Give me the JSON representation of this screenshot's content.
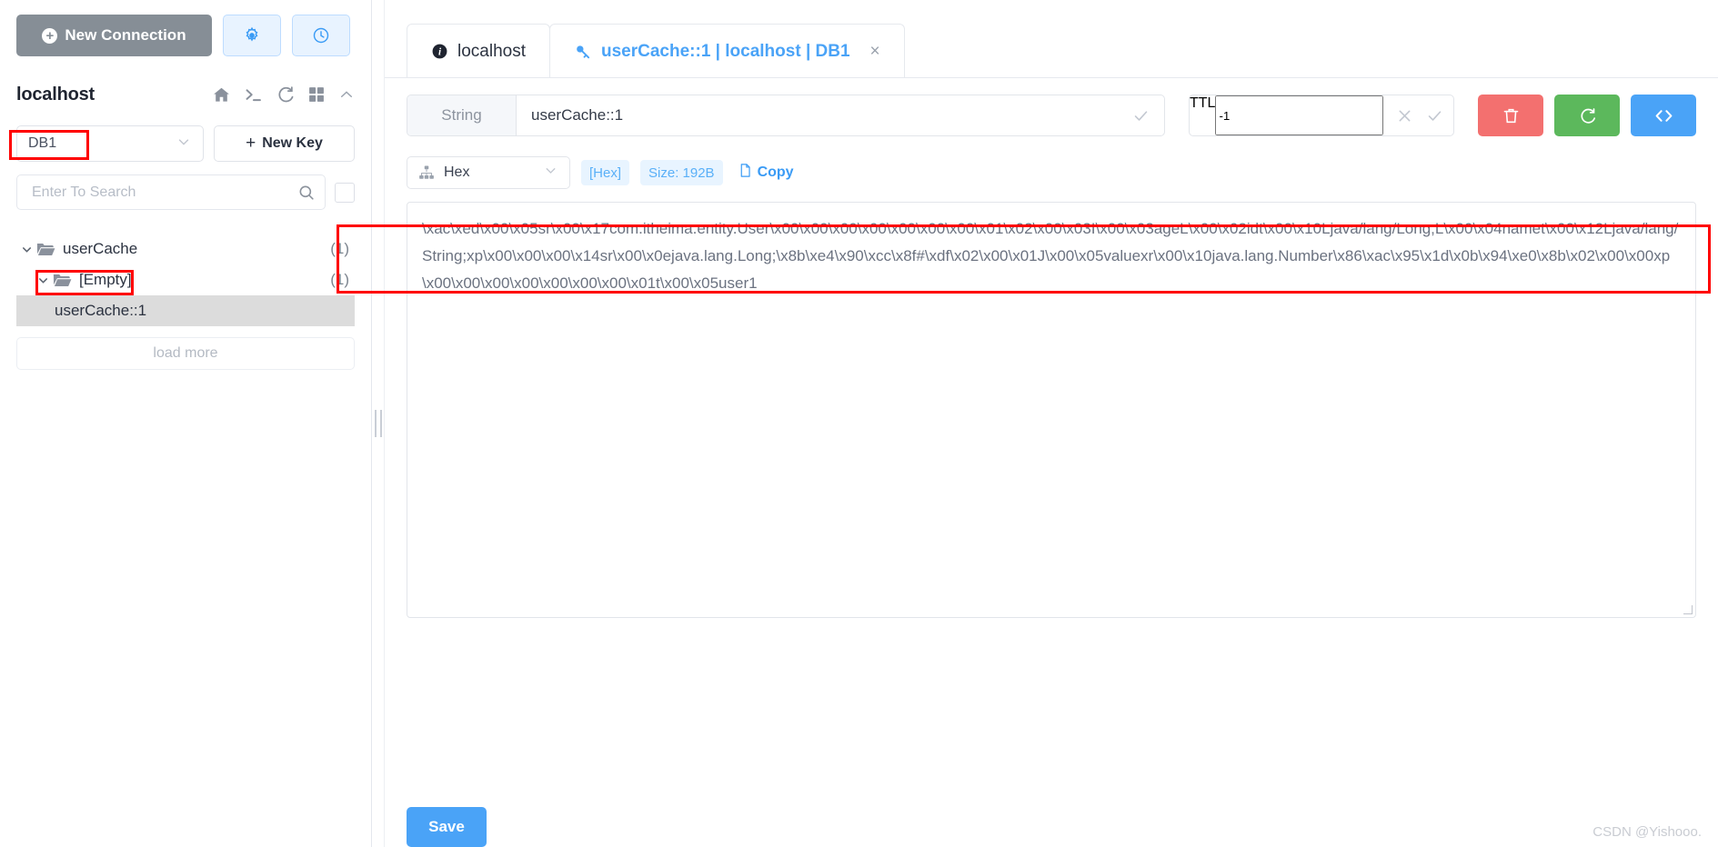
{
  "sidebar": {
    "new_connection_label": "New Connection",
    "icon_buttons": [
      {
        "name": "settings-gear-icon",
        "label": "settings"
      },
      {
        "name": "history-clock-icon",
        "label": "history"
      }
    ],
    "host_name": "localhost",
    "host_icons": [
      {
        "name": "home-icon"
      },
      {
        "name": "terminal-icon"
      },
      {
        "name": "refresh-icon"
      },
      {
        "name": "grid-icon"
      },
      {
        "name": "chevron-up-icon"
      }
    ],
    "db_select_value": "DB1",
    "new_key_label": "New Key",
    "search_placeholder": "Enter To Search",
    "search_value": "",
    "tree": [
      {
        "label": "userCache",
        "count": "(1)",
        "level": 1,
        "expanded": true,
        "type": "folder",
        "selected": false
      },
      {
        "label": "[Empty]",
        "count": "(1)",
        "level": 2,
        "expanded": true,
        "type": "folder",
        "selected": false
      },
      {
        "label": "userCache::1",
        "count": "",
        "level": 3,
        "expanded": false,
        "type": "key",
        "selected": true
      }
    ],
    "load_more_label": "load more"
  },
  "tabs": [
    {
      "label": "localhost",
      "icon": "info-icon",
      "active": false,
      "closable": false
    },
    {
      "label": "userCache::1 | localhost | DB1",
      "icon": "key-icon",
      "active": true,
      "closable": true,
      "close_label": "×"
    }
  ],
  "key_bar": {
    "type_label": "String",
    "key_value": "userCache::1",
    "key_confirm_icon": "check-icon",
    "ttl_label": "TTL",
    "ttl_value": "-1",
    "ttl_cancel_icon": "close-icon",
    "ttl_confirm_icon": "check-icon",
    "actions": [
      {
        "name": "delete-key-button",
        "icon": "trash-icon",
        "color": "#f3706f"
      },
      {
        "name": "refresh-key-button",
        "icon": "refresh-icon",
        "color": "#5cb85c"
      },
      {
        "name": "code-view-button",
        "icon": "code-icon",
        "color": "#4aa3f7"
      }
    ]
  },
  "format_bar": {
    "format_value": "Hex",
    "format_icon": "sitemap-icon",
    "detected_chip": "[Hex]",
    "size_chip": "Size: 192B",
    "copy_label": "Copy",
    "copy_icon": "document-icon"
  },
  "value": {
    "content": "\\xac\\xed\\x00\\x05sr\\x00\\x17com.itheima.entity.User\\x00\\x00\\x00\\x00\\x00\\x00\\x00\\x01\\x02\\x00\\x03I\\x00\\x03ageL\\x00\\x02idt\\x00\\x10Ljava/lang/Long;L\\x00\\x04namet\\x00\\x12Ljava/lang/String;xp\\x00\\x00\\x00\\x14sr\\x00\\x0ejava.lang.Long;\\x8b\\xe4\\x90\\xcc\\x8f#\\xdf\\x02\\x00\\x01J\\x00\\x05valuexr\\x00\\x10java.lang.Number\\x86\\xac\\x95\\x1d\\x0b\\x94\\xe0\\x8b\\x02\\x00\\x00xp\\x00\\x00\\x00\\x00\\x00\\x00\\x00\\x01t\\x00\\x05user1"
  },
  "footer": {
    "save_label": "Save",
    "watermark": "CSDN @Yishooo."
  },
  "colors": {
    "accent": "#4aa3f7",
    "danger": "#f3706f",
    "success": "#5cb85c",
    "highlight": "#ff0000",
    "muted": "#868e96"
  }
}
